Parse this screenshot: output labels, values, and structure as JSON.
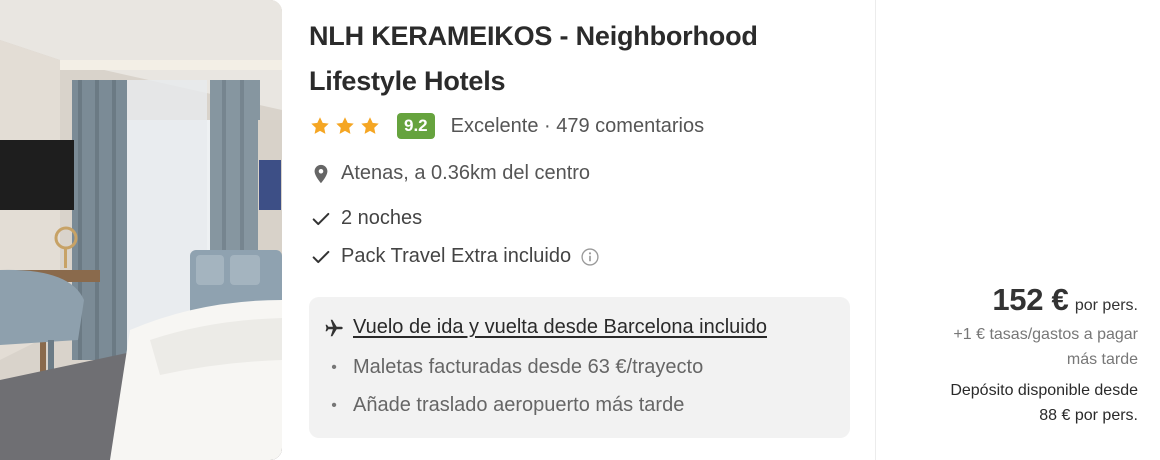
{
  "hotel": {
    "name": "NLH KERAMEIKOS - Neighborhood Lifestyle Hotels",
    "stars": 3,
    "score": "9.2",
    "rating_text": "Excelente · 479 comentarios",
    "location": "Atenas, a 0.36km del centro"
  },
  "features": {
    "nights": "2 noches",
    "pack": "Pack Travel Extra incluido"
  },
  "flight": {
    "title": "Vuelo de ida y vuelta desde Barcelona incluido",
    "bullet_1": "Maletas facturadas desde 63 €/trayecto",
    "bullet_2": "Añade traslado aeropuerto más tarde"
  },
  "price": {
    "amount": "152 €",
    "per": "por pers.",
    "taxes_line_1": "+1 € tasas/gastos a pagar",
    "taxes_line_2": "más tarde",
    "deposit_line_1": "Depósito disponible desde",
    "deposit_line_2": "88 € por pers."
  },
  "colors": {
    "score_badge": "#66a33e",
    "star": "#f5a623",
    "flight_box": "#f2f2f2"
  },
  "icons": {
    "star": "star-icon",
    "location": "map-pin-icon",
    "check": "check-icon",
    "info": "info-icon",
    "plane": "plane-icon"
  }
}
